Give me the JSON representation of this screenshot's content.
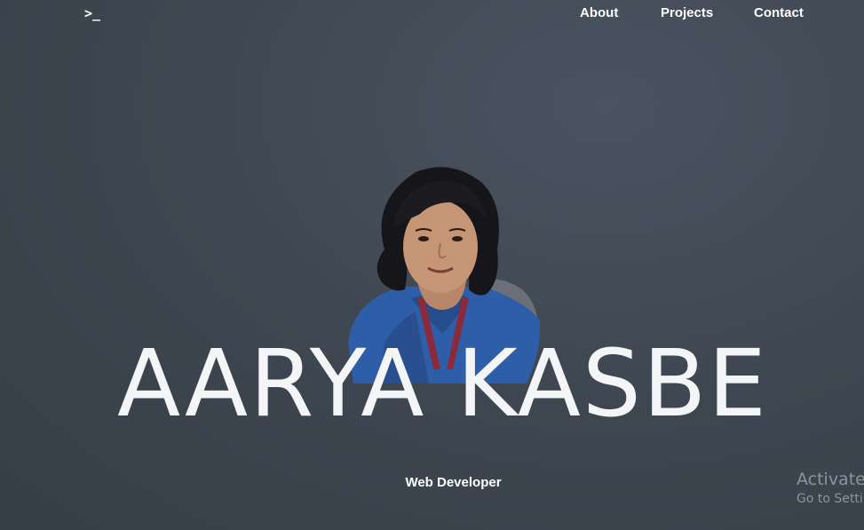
{
  "header": {
    "logo": ">_",
    "nav": {
      "about": "About",
      "projects": "Projects",
      "contact": "Contact"
    }
  },
  "hero": {
    "name": "AARYA KASBE",
    "role": "Web Developer"
  },
  "watermark": {
    "title": "Activate",
    "subtitle": "Go to Settir"
  },
  "colors": {
    "background": "#3f4852",
    "text": "#ffffff",
    "watermark": "#8d949b"
  }
}
